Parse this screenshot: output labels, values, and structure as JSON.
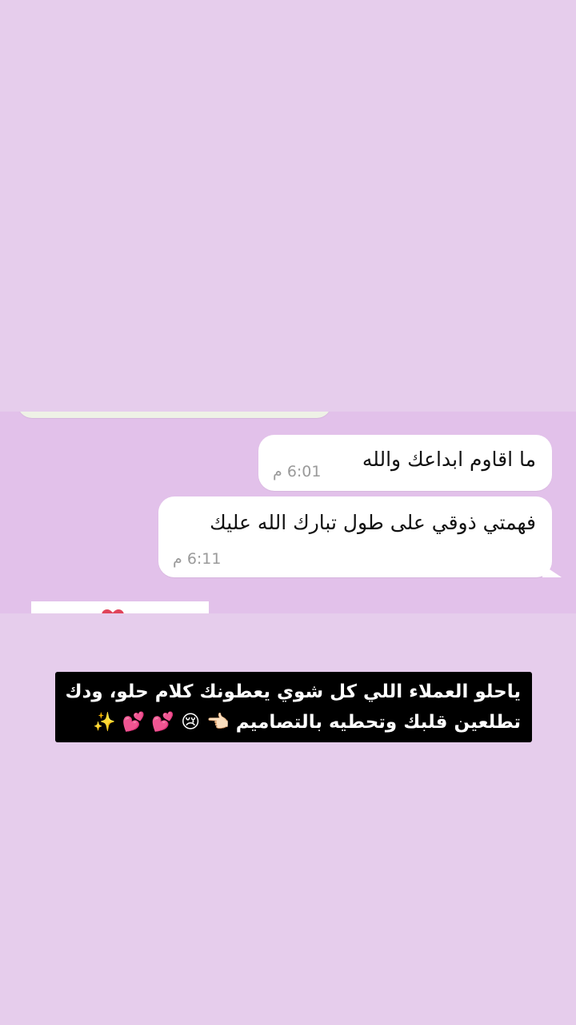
{
  "chat": {
    "messages": [
      {
        "text": "ما اقاوم ابداعك والله",
        "time": "6:01 م"
      },
      {
        "text": "فهمتي ذوقي على طول تبارك الله عليك",
        "time": "6:11 م"
      }
    ]
  },
  "caption": {
    "text": "ياحلو العملاء اللي كل شوي يعطونك كلام حلو، ودك تطلعين قلبك وتحطيه بالتصاميم 👈🏻 😢 💕 💕 ✨"
  },
  "colors": {
    "story_background": "#e6cdec",
    "chat_background": "#e2c1ea",
    "bubble": "#ffffff",
    "caption_background": "#000000",
    "caption_text": "#ffffff",
    "timestamp": "#9a9a9a",
    "previous_bubble": "#eef1e6",
    "heart": "#e0445a"
  }
}
